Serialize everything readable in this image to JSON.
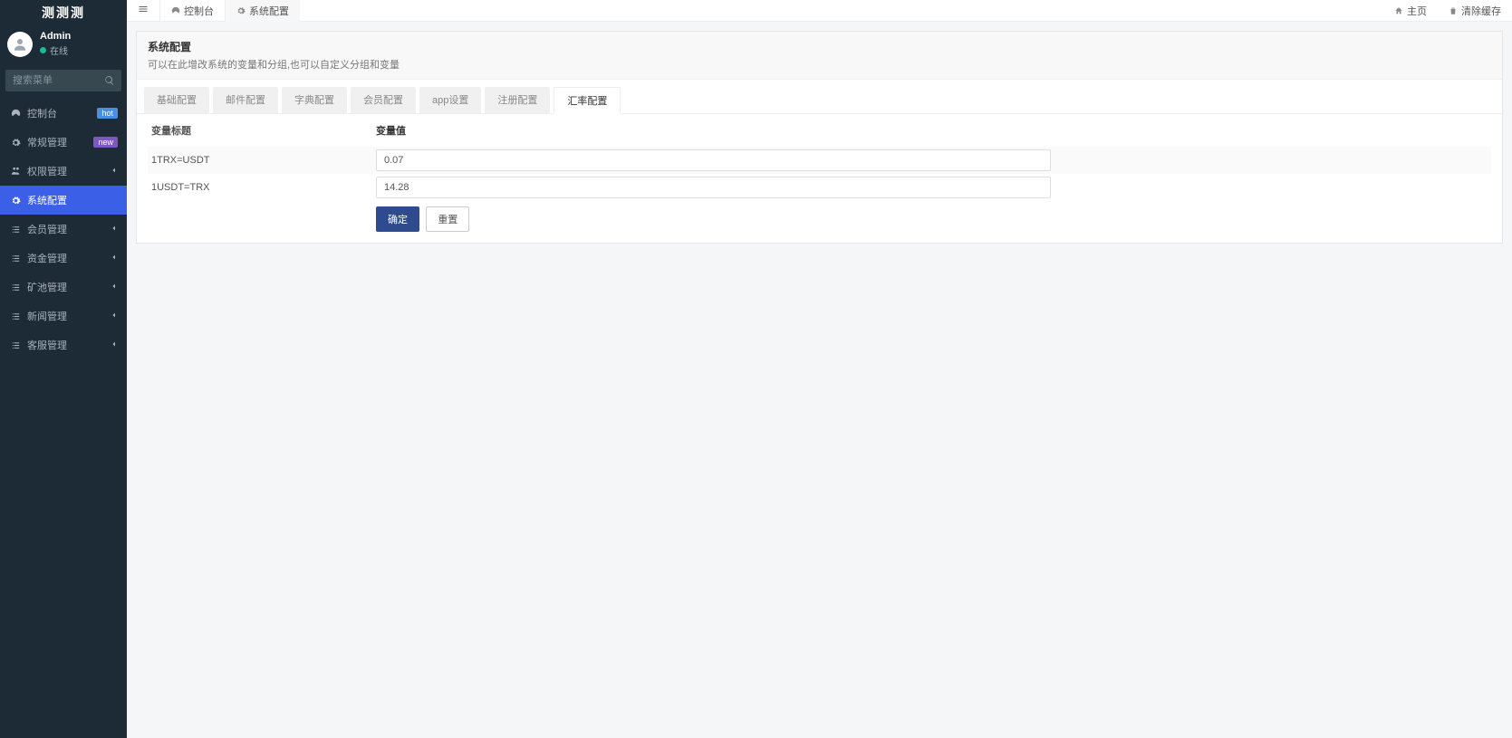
{
  "logo": "测测测",
  "user": {
    "name": "Admin",
    "status": "在线"
  },
  "search": {
    "placeholder": "搜索菜单"
  },
  "sidebar": {
    "items": [
      {
        "label": "控制台",
        "badge": "hot"
      },
      {
        "label": "常规管理",
        "badge": "new"
      },
      {
        "label": "权限管理"
      },
      {
        "label": "系统配置",
        "active": true
      },
      {
        "label": "会员管理"
      },
      {
        "label": "资金管理"
      },
      {
        "label": "矿池管理"
      },
      {
        "label": "新闻管理"
      },
      {
        "label": "客服管理"
      }
    ]
  },
  "top_tabs": [
    {
      "label": "控制台",
      "icon": "dashboard"
    },
    {
      "label": "系统配置",
      "icon": "gear",
      "active": true
    }
  ],
  "top_right": [
    {
      "label": "主页",
      "icon": "home"
    },
    {
      "label": "清除缓存",
      "icon": "trash"
    }
  ],
  "panel": {
    "title": "系统配置",
    "desc": "可以在此增改系统的变量和分组,也可以自定义分组和变量"
  },
  "config_tabs": [
    "基础配置",
    "邮件配置",
    "字典配置",
    "会员配置",
    "app设置",
    "注册配置",
    "汇率配置"
  ],
  "config_active_index": 6,
  "table": {
    "header_label": "变量标题",
    "header_value": "变量值",
    "rows": [
      {
        "label": "1TRX=USDT",
        "value": "0.07"
      },
      {
        "label": "1USDT=TRX",
        "value": "14.28"
      }
    ]
  },
  "actions": {
    "submit": "确定",
    "reset": "重置"
  }
}
